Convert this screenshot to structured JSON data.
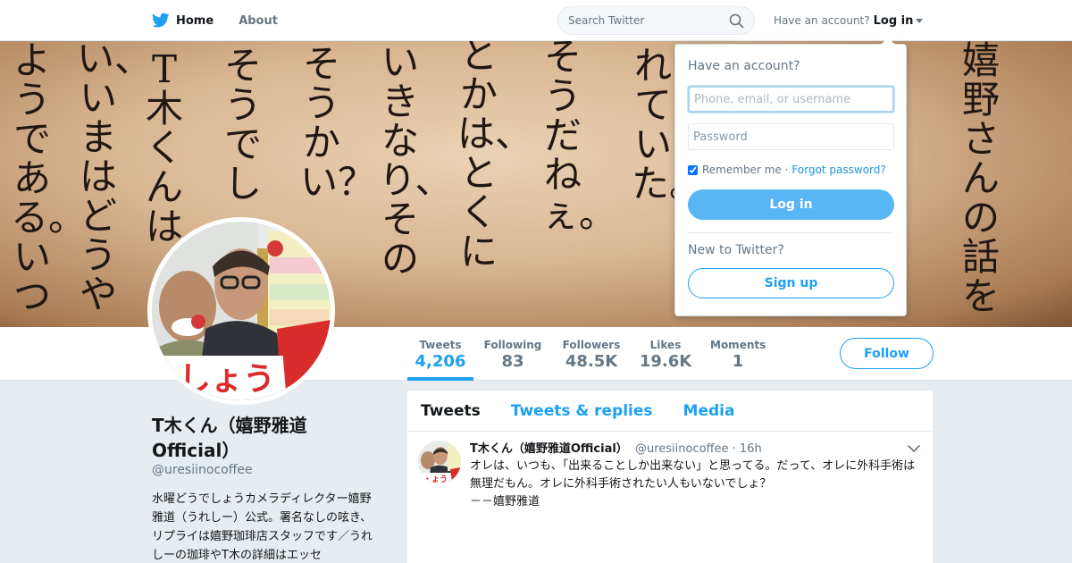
{
  "nav": {
    "home_label": "Home",
    "about_label": "About",
    "search_placeholder": "Search Twitter",
    "have_account_text": "Have an account?",
    "login_label": "Log in"
  },
  "banner": {
    "columns": [
      "嬉野さんの話を",
      "れていた。",
      "そうだねぇ。",
      "とかは、とくに",
      "いきなり、その",
      "そうかい？",
      "そうでし",
      "T木くんは",
      "い、いまはどうや",
      "ようである。いつ"
    ]
  },
  "profile": {
    "display_name": "T木くん（嬉野雅道Official）",
    "screen_name": "@uresiinocoffee",
    "bio": "水曜どうでしょうカメラディレクター嬉野雅道（うれしー）公式。署名なしの呟き、リプライは嬉野珈琲店スタッフです／うれしーの珈琲やT木の詳細はエッセ",
    "avatar_text": "しょう"
  },
  "stats": [
    {
      "label": "Tweets",
      "value": "4,206"
    },
    {
      "label": "Following",
      "value": "83"
    },
    {
      "label": "Followers",
      "value": "48.5K"
    },
    {
      "label": "Likes",
      "value": "19.6K"
    },
    {
      "label": "Moments",
      "value": "1"
    }
  ],
  "follow_label": "Follow",
  "timeline": {
    "tabs": [
      "Tweets",
      "Tweets & replies",
      "Media"
    ],
    "tweet": {
      "name": "T木くん（嬉野雅道Official）",
      "handle": "@uresiinocoffee",
      "time": "· 16h",
      "text": "オレは、いつも、「出来ることしか出来ない」と思ってる。だって、オレに外科手術は無理だもん。オレに外科手術されたい人もいないでしょ？\n－－嬉野雅道"
    }
  },
  "login_dropdown": {
    "title": "Have an account?",
    "username_placeholder": "Phone, email, or username",
    "password_placeholder": "Password",
    "remember_label": "Remember me ·",
    "forgot_label": "Forgot password?",
    "login_button": "Log in",
    "new_text": "New to Twitter?",
    "signup_button": "Sign up"
  },
  "colors": {
    "accent": "#1da1f2",
    "login_button_bg": "#58b6f5",
    "background": "#e6ecf0"
  }
}
